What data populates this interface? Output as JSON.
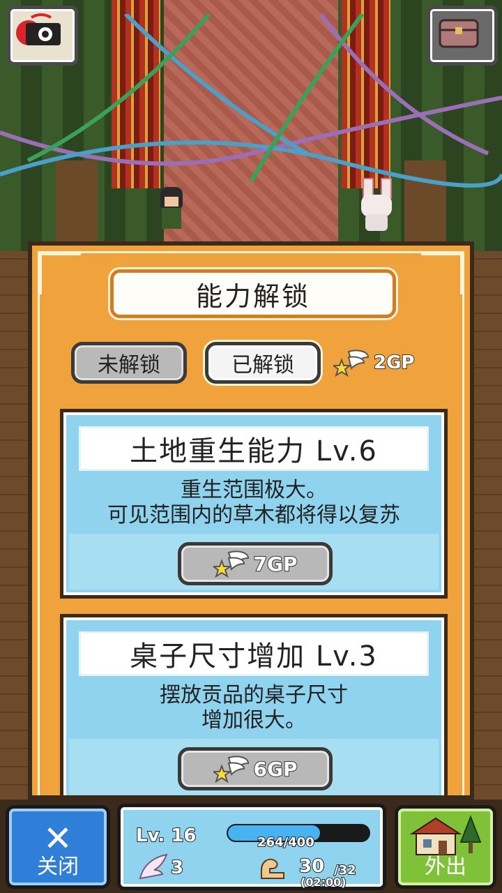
{
  "panel": {
    "title": "能力解锁",
    "tabs": {
      "locked": "未解锁",
      "unlocked": "已解锁"
    },
    "gp_total": "2GP"
  },
  "abilities": [
    {
      "title": "土地重生能力 Lv.6",
      "desc_line1": "重生范围极大。",
      "desc_line2": "可见范围内的草木都将得以复苏",
      "cost": "7GP"
    },
    {
      "title": "桌子尺寸增加 Lv.3",
      "desc_line1": "摆放贡品的桌子尺寸",
      "desc_line2": "增加很大。",
      "cost": "6GP"
    }
  ],
  "status": {
    "level": "Lv. 16",
    "xp": "264/400",
    "xp_fraction": 0.66,
    "wings": "3",
    "stamina": "30",
    "stamina_max": "/32",
    "stamina_timer": "(02:00)"
  },
  "buttons": {
    "close": "关闭",
    "out": "外出"
  },
  "icons": {
    "screenshot": "camera-icon",
    "chest": "treasure-chest-icon",
    "gp": "winged-star-icon",
    "close": "x-icon",
    "out": "house-tree-icon",
    "wing": "feather-wing-icon",
    "stamina": "muscle-arm-icon"
  },
  "colors": {
    "panel": "#f0a23c",
    "card": "#8fd3ee",
    "close": "#2f7fd8",
    "out": "#7fc23a"
  }
}
